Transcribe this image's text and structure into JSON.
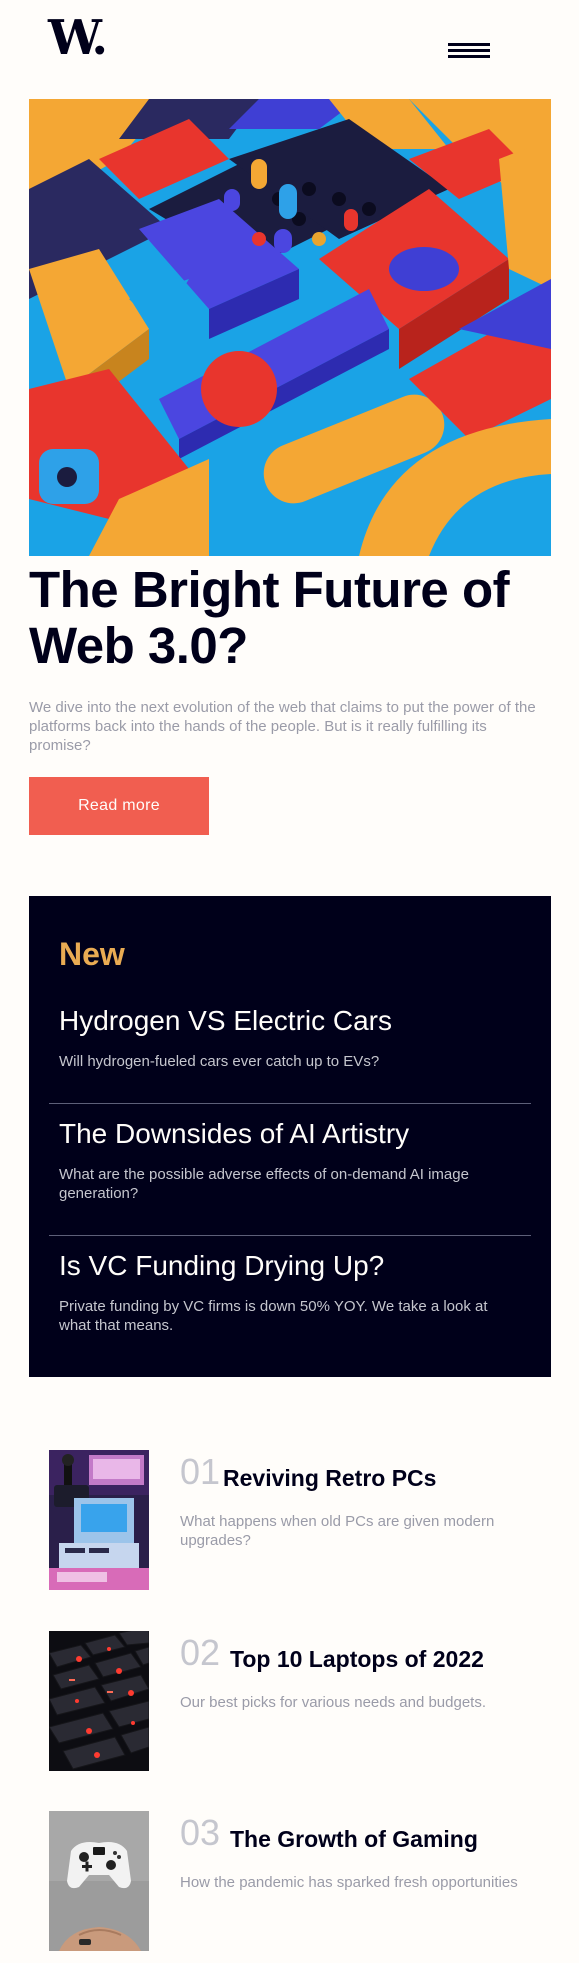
{
  "header": {
    "logo": "W.",
    "menu_icon": "hamburger-menu-icon"
  },
  "hero": {
    "title": "The Bright Future of Web 3.0?",
    "description": "We dive into the next evolution of the web that claims to put the power of the platforms back into the hands of the people. But is it really fulfilling its promise?",
    "button_label": "Read more"
  },
  "new_section": {
    "heading": "New",
    "items": [
      {
        "title": "Hydrogen VS Electric Cars",
        "description": "Will hydrogen-fueled cars ever catch up to EVs?"
      },
      {
        "title": "The Downsides of AI Artistry",
        "description": "What are the possible adverse effects of on-demand AI image generation?"
      },
      {
        "title": "Is VC Funding Drying Up?",
        "description": "Private funding by VC firms is down 50% YOY. We take a look at what that means."
      }
    ]
  },
  "articles": [
    {
      "number": "01",
      "title": "Reviving Retro PCs",
      "description": "What happens when old PCs are given modern upgrades?"
    },
    {
      "number": "02",
      "title": "Top 10 Laptops of 2022",
      "description": "Our best picks for various needs and budgets."
    },
    {
      "number": "03",
      "title": "The Growth of Gaming",
      "description": "How the pandemic has sparked fresh opportunities"
    }
  ],
  "colors": {
    "background": "#fffdfa",
    "dark": "#00001a",
    "accent_red": "#f15e50",
    "accent_orange": "#e9ab53",
    "muted": "#9a9ba8"
  }
}
